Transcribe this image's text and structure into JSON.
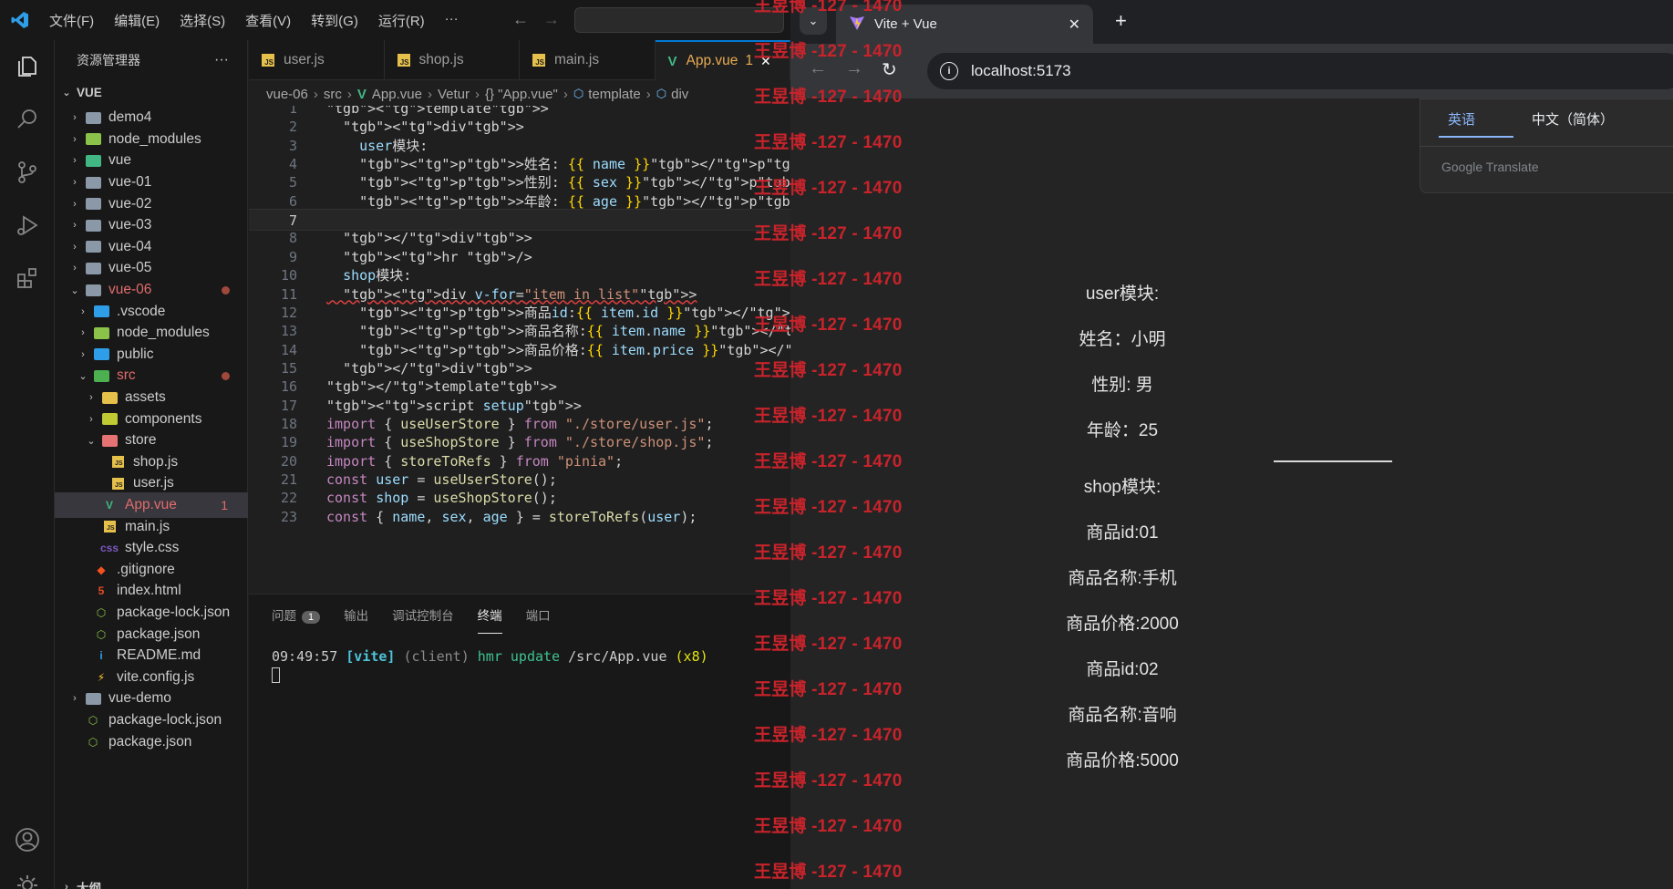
{
  "vscode": {
    "menu": [
      "文件(F)",
      "编辑(E)",
      "选择(S)",
      "查看(V)",
      "转到(G)",
      "运行(R)",
      "···"
    ],
    "explorer": {
      "title": "资源管理器",
      "more": "···",
      "root": "VUE",
      "outline_label": "大纲",
      "tree": [
        {
          "label": "demo4",
          "indent": 1,
          "icon": "folder-icon",
          "chevron": "›"
        },
        {
          "label": "node_modules",
          "indent": 1,
          "icon": "node-modules-folder-icon",
          "chevron": "›"
        },
        {
          "label": "vue",
          "indent": 1,
          "icon": "vue-folder-icon",
          "chevron": "›"
        },
        {
          "label": "vue-01",
          "indent": 1,
          "icon": "folder-icon",
          "chevron": "›"
        },
        {
          "label": "vue-02",
          "indent": 1,
          "icon": "folder-icon",
          "chevron": "›"
        },
        {
          "label": "vue-03",
          "indent": 1,
          "icon": "folder-icon",
          "chevron": "›"
        },
        {
          "label": "vue-04",
          "indent": 1,
          "icon": "folder-icon",
          "chevron": "›"
        },
        {
          "label": "vue-05",
          "indent": 1,
          "icon": "folder-icon",
          "chevron": "›"
        },
        {
          "label": "vue-06",
          "indent": 1,
          "icon": "folder-open-icon",
          "chevron": "⌄",
          "modified": true,
          "color": "#e06c6c"
        },
        {
          "label": ".vscode",
          "indent": 2,
          "icon": "vscode-folder-icon",
          "chevron": "›"
        },
        {
          "label": "node_modules",
          "indent": 2,
          "icon": "node-modules-folder-icon",
          "chevron": "›"
        },
        {
          "label": "public",
          "indent": 2,
          "icon": "public-folder-icon",
          "chevron": "›"
        },
        {
          "label": "src",
          "indent": 2,
          "icon": "src-folder-icon",
          "chevron": "⌄",
          "modified": true,
          "color": "#e06c6c"
        },
        {
          "label": "assets",
          "indent": 3,
          "icon": "assets-folder-icon",
          "chevron": "›"
        },
        {
          "label": "components",
          "indent": 3,
          "icon": "components-folder-icon",
          "chevron": "›"
        },
        {
          "label": "store",
          "indent": 3,
          "icon": "store-folder-icon",
          "chevron": "⌄"
        },
        {
          "label": "shop.js",
          "indent": 4,
          "icon": "js-file-icon",
          "chevron": ""
        },
        {
          "label": "user.js",
          "indent": 4,
          "icon": "js-file-icon",
          "chevron": ""
        },
        {
          "label": "App.vue",
          "indent": 3,
          "icon": "vue-file-icon",
          "chevron": "",
          "selected": true,
          "badge": "1",
          "color": "#e06c6c"
        },
        {
          "label": "main.js",
          "indent": 3,
          "icon": "js-file-icon",
          "chevron": ""
        },
        {
          "label": "style.css",
          "indent": 3,
          "icon": "css-file-icon",
          "chevron": ""
        },
        {
          "label": ".gitignore",
          "indent": 2,
          "icon": "git-file-icon",
          "chevron": ""
        },
        {
          "label": "index.html",
          "indent": 2,
          "icon": "html-file-icon",
          "chevron": ""
        },
        {
          "label": "package-lock.json",
          "indent": 2,
          "icon": "node-file-icon",
          "chevron": ""
        },
        {
          "label": "package.json",
          "indent": 2,
          "icon": "node-file-icon",
          "chevron": ""
        },
        {
          "label": "README.md",
          "indent": 2,
          "icon": "info-file-icon",
          "chevron": ""
        },
        {
          "label": "vite.config.js",
          "indent": 2,
          "icon": "vite-file-icon",
          "chevron": ""
        },
        {
          "label": "vue-demo",
          "indent": 1,
          "icon": "folder-icon",
          "chevron": "›"
        },
        {
          "label": "package-lock.json",
          "indent": 1,
          "icon": "node-file-icon",
          "chevron": ""
        },
        {
          "label": "package.json",
          "indent": 1,
          "icon": "node-file-icon",
          "chevron": ""
        }
      ]
    },
    "tabs": [
      {
        "label": "user.js",
        "type": "js"
      },
      {
        "label": "shop.js",
        "type": "js"
      },
      {
        "label": "main.js",
        "type": "js"
      },
      {
        "label": "App.vue",
        "type": "vue",
        "active": true,
        "badge": "1"
      }
    ],
    "breadcrumb": [
      "vue-06",
      "src",
      "App.vue",
      "Vetur",
      "{} \"App.vue\"",
      "template",
      "div"
    ],
    "code_lines": [
      "<template>",
      "  <div>",
      "    user模块:",
      "    <p>姓名: {{ name }}</p>",
      "    <p>性别: {{ sex }}</p>",
      "    <p>年龄: {{ age }}</p>",
      "    ",
      "  </div>",
      "  <hr />",
      "  shop模块:",
      "  <div v-for=\"item in list\">",
      "    <p>商品id:{{ item.id }}</p>",
      "    <p>商品名称:{{ item.name }}</p>",
      "    <p>商品价格:{{ item.price }}</p>",
      "  </div>",
      "</template>",
      "<script setup>",
      "import { useUserStore } from \"./store/user.js\";",
      "import { useShopStore } from \"./store/shop.js\";",
      "import { storeToRefs } from \"pinia\";",
      "const user = useUserStore();",
      "const shop = useShopStore();",
      "const { name, sex, age } = storeToRefs(user);"
    ],
    "panel": {
      "tabs": [
        "问题",
        "输出",
        "调试控制台",
        "终端",
        "端口"
      ],
      "problems_count": "1",
      "active_tab": "终端",
      "terminal": {
        "time": "09:49:57",
        "tag": "[vite]",
        "client": "(client)",
        "msg": "hmr update",
        "path": "/src/App.vue",
        "count": "(x8)"
      }
    }
  },
  "browser": {
    "tab_title": "Vite + Vue",
    "url": "localhost:5173",
    "translate": {
      "tab_en": "英语",
      "tab_zh": "中文（简体）",
      "brand": "Google Translate"
    },
    "page": {
      "user_title": "user模块:",
      "name": "姓名：小明",
      "sex": "性别: 男",
      "age": "年龄：25",
      "shop_title": "shop模块:",
      "items": [
        {
          "id": "商品id:01",
          "name": "商品名称:手机",
          "price": "商品价格:2000"
        },
        {
          "id": "商品id:02",
          "name": "商品名称:音响",
          "price": "商品价格:5000"
        }
      ]
    }
  },
  "watermark": "王昱博 -127 - 1470",
  "colors": {
    "accent": "#0078d4",
    "modified": "#e06c6c",
    "watermark": "#c8232b"
  }
}
